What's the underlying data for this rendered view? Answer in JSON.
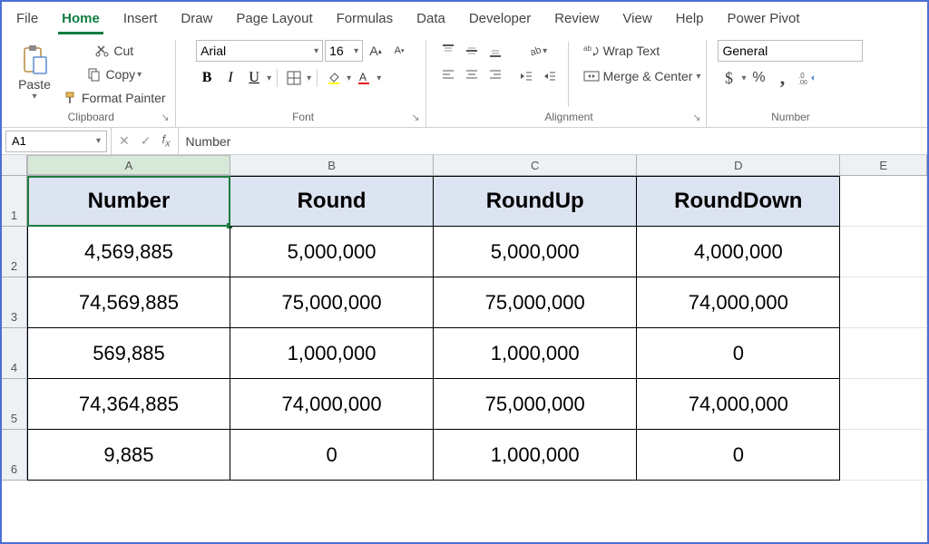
{
  "menu": {
    "tabs": [
      "File",
      "Home",
      "Insert",
      "Draw",
      "Page Layout",
      "Formulas",
      "Data",
      "Developer",
      "Review",
      "View",
      "Help",
      "Power Pivot"
    ],
    "active": "Home"
  },
  "ribbon": {
    "clipboard": {
      "paste": "Paste",
      "cut": "Cut",
      "copy": "Copy",
      "format_painter": "Format Painter",
      "group_label": "Clipboard"
    },
    "font": {
      "name": "Arial",
      "size": "16",
      "group_label": "Font"
    },
    "alignment": {
      "wrap": "Wrap Text",
      "merge": "Merge & Center",
      "group_label": "Alignment"
    },
    "number": {
      "format": "General",
      "group_label": "Number"
    }
  },
  "formula_bar": {
    "name_box": "A1",
    "value": "Number"
  },
  "grid": {
    "columns": [
      "A",
      "B",
      "C",
      "D",
      "E"
    ],
    "header_row": [
      "Number",
      "Round",
      "RoundUp",
      "RoundDown"
    ],
    "rows": [
      [
        "4,569,885",
        "5,000,000",
        "5,000,000",
        "4,000,000"
      ],
      [
        "74,569,885",
        "75,000,000",
        "75,000,000",
        "74,000,000"
      ],
      [
        "569,885",
        "1,000,000",
        "1,000,000",
        "0"
      ],
      [
        "74,364,885",
        "74,000,000",
        "75,000,000",
        "74,000,000"
      ],
      [
        "9,885",
        "0",
        "1,000,000",
        "0"
      ]
    ],
    "active_cell": "A1"
  }
}
